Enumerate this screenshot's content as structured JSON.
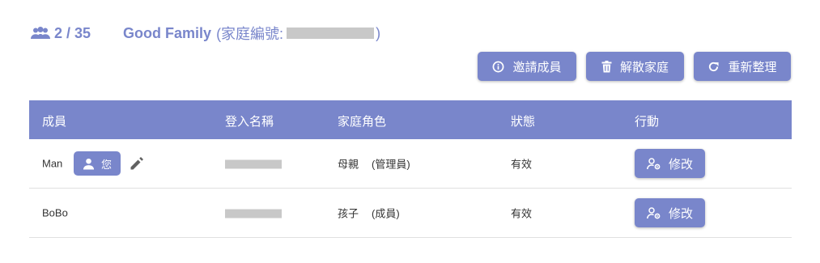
{
  "header": {
    "member_count": "2 / 35",
    "family_name": "Good Family",
    "family_id_label": "(家庭編號:",
    "family_id_close": ")"
  },
  "actions": {
    "invite_label": "邀請成員",
    "disband_label": "解散家庭",
    "refresh_label": "重新整理"
  },
  "table": {
    "columns": [
      "成員",
      "登入名稱",
      "家庭角色",
      "狀態",
      "行動"
    ],
    "rows": [
      {
        "member": "Man",
        "you_badge": "您",
        "role": "母親",
        "role_type": "(管理員)",
        "status": "有效",
        "action": "修改"
      },
      {
        "member": "BoBo",
        "role": "孩子",
        "role_type": "(成員)",
        "status": "有效",
        "action": "修改"
      }
    ]
  },
  "icons": {
    "members": "group-icon",
    "invite": "info-circle-icon",
    "disband": "trash-icon",
    "refresh": "refresh-icon",
    "you": "person-icon",
    "edit": "pencil-icon",
    "modify": "person-gear-icon"
  },
  "colors": {
    "accent": "#7986cb"
  }
}
